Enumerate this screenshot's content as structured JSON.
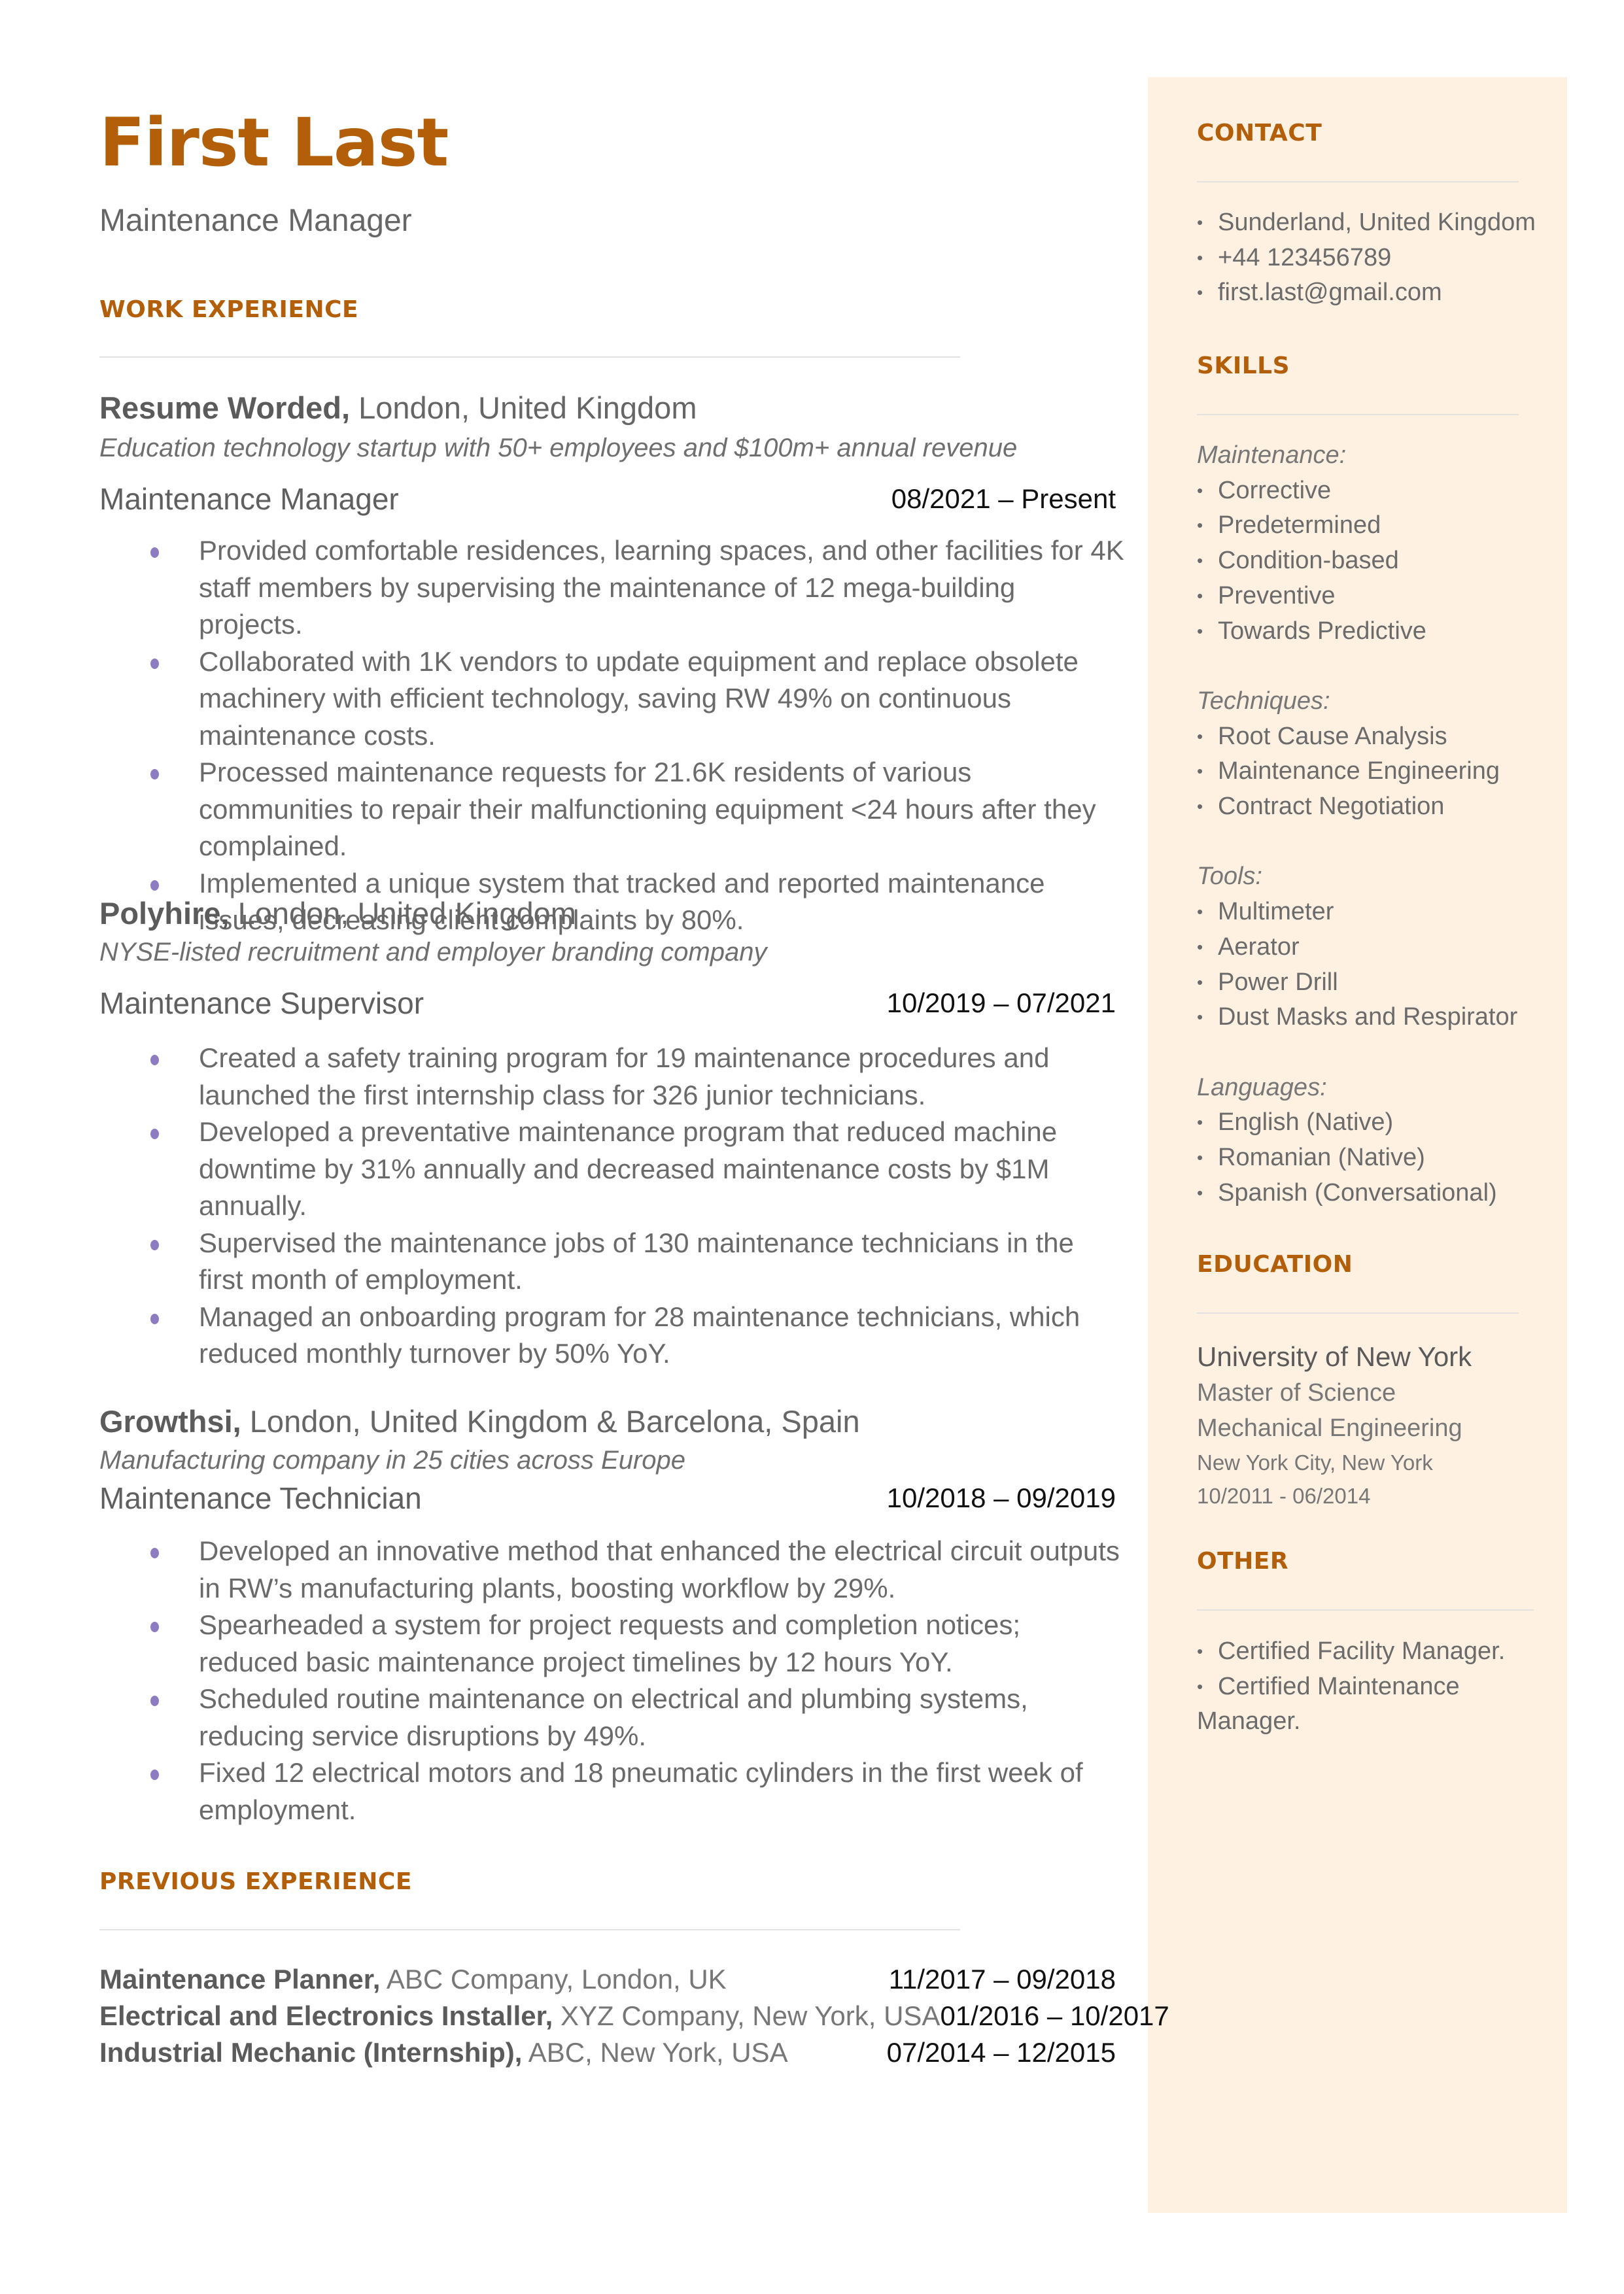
{
  "header": {
    "name": "First Last",
    "title": "Maintenance Manager"
  },
  "colors": {
    "accent": "#b35f0a",
    "bullet": "#8e7cc3",
    "sidebar_bg": "#fff1e2",
    "text": "#666666"
  },
  "work_experience": {
    "heading": "WORK EXPERIENCE",
    "jobs": [
      {
        "company": "Resume Worded,",
        "location": " London, United Kingdom",
        "description": "Education technology startup with 50+ employees and $100m+ annual revenue",
        "role": "Maintenance Manager",
        "dates": "08/2021 – Present",
        "bullets": [
          "Provided comfortable residences, learning spaces, and other facilities for 4K staff members by supervising the maintenance of 12 mega-building projects.",
          "Collaborated with 1K vendors to update equipment and replace obsolete machinery with efficient technology, saving RW 49% on continuous maintenance costs.",
          "Processed maintenance requests for 21.6K residents of various communities to repair their malfunctioning equipment <24 hours after they complained.",
          "Implemented a unique system that tracked and reported maintenance issues, decreasing client complaints by 80%."
        ]
      },
      {
        "company": "Polyhire,",
        "location": " London, United Kingdom",
        "description": "NYSE-listed recruitment and employer branding company",
        "role": "Maintenance Supervisor",
        "dates": "10/2019 – 07/2021",
        "bullets": [
          "Created a safety training program for 19 maintenance procedures and launched the first internship class for 326 junior technicians.",
          "Developed a preventative maintenance program that reduced machine downtime by 31% annually and decreased maintenance costs by $1M annually.",
          "Supervised the maintenance jobs of 130 maintenance technicians in the first month of employment.",
          "Managed an onboarding program for 28 maintenance technicians, which reduced monthly turnover by 50% YoY."
        ]
      },
      {
        "company": "Growthsi,",
        "location": " London, United Kingdom & Barcelona, Spain",
        "description": "Manufacturing company in 25 cities across Europe",
        "role": "Maintenance Technician",
        "dates": "10/2018 – 09/2019",
        "bullets": [
          "Developed an innovative method that enhanced the electrical circuit outputs in RW’s manufacturing plants, boosting workflow by 29%.",
          "Spearheaded a system for project requests and completion notices; reduced basic maintenance project timelines by 12 hours YoY.",
          "Scheduled routine maintenance on electrical and plumbing systems, reducing service disruptions by 49%.",
          "Fixed 12 electrical motors and 18 pneumatic cylinders in the first week of employment."
        ]
      }
    ]
  },
  "previous_experience": {
    "heading": "PREVIOUS EXPERIENCE",
    "items": [
      {
        "title": "Maintenance Planner,",
        "details": " ABC Company, London, UK",
        "dates": "11/2017 – 09/2018"
      },
      {
        "title": "Electrical and Electronics Installer,",
        "details": " XYZ Company, New York, USA",
        "dates": "01/2016 – 10/2017"
      },
      {
        "title": "Industrial Mechanic (Internship),",
        "details": " ABC, New York, USA",
        "dates": "07/2014 – 12/2015"
      }
    ]
  },
  "sidebar": {
    "contact": {
      "heading": "CONTACT",
      "items": [
        "Sunderland, United Kingdom",
        "+44 123456789",
        "first.last@gmail.com"
      ]
    },
    "skills": {
      "heading": "SKILLS",
      "groups": [
        {
          "label": "Maintenance:",
          "items": [
            "Corrective",
            "Predetermined",
            "Condition-based",
            "Preventive",
            "Towards Predictive"
          ]
        },
        {
          "label": "Techniques:",
          "items": [
            "Root Cause Analysis",
            "Maintenance Engineering",
            "Contract Negotiation"
          ]
        },
        {
          "label": "Tools:",
          "items": [
            "Multimeter",
            "Aerator",
            "Power Drill",
            "Dust Masks and Respirator"
          ]
        },
        {
          "label": "Languages:",
          "items": [
            "English (Native)",
            "Romanian (Native)",
            "Spanish (Conversational)"
          ]
        }
      ]
    },
    "education": {
      "heading": "EDUCATION",
      "school": "University of New York",
      "degree": "Master of Science",
      "field": "Mechanical Engineering",
      "location": "New York City, New York",
      "dates": "10/2011 - 06/2014"
    },
    "other": {
      "heading": "OTHER",
      "items": [
        "Certified Facility Manager.",
        "Certified Maintenance"
      ],
      "continuation": "Manager."
    }
  }
}
